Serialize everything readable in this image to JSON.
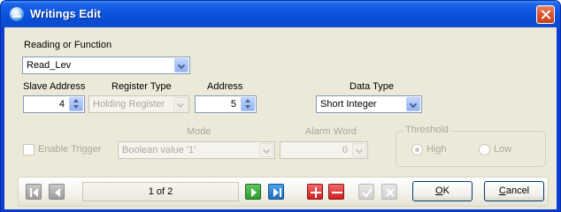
{
  "window": {
    "title": "Writings Edit",
    "close_icon": "close-icon"
  },
  "reading": {
    "label": "Reading or Function",
    "value": "Read_Lev"
  },
  "slave_address": {
    "label": "Slave Address",
    "value": "4"
  },
  "register_type": {
    "label": "Register Type",
    "value": "Holding Register"
  },
  "address": {
    "label": "Address",
    "value": "5"
  },
  "data_type": {
    "label": "Data Type",
    "value": "Short Integer"
  },
  "trigger": {
    "label": "Enable Trigger",
    "checked": false
  },
  "mode": {
    "label": "Mode",
    "value": "Boolean value '1'"
  },
  "alarm_word": {
    "label": "Alarm Word",
    "value": "0"
  },
  "threshold": {
    "label": "Threshold",
    "options": [
      "High",
      "Low"
    ],
    "selected": "High"
  },
  "navigation": {
    "page": "1 of 2"
  },
  "buttons": {
    "ok": "OK",
    "ok_mnemonic": "O",
    "ok_rest": "K",
    "cancel": "Cancel",
    "cancel_mnemonic": "C",
    "cancel_rest": "ancel"
  },
  "colors": {
    "title_bar": "#0a4bd1",
    "client": "#ece9d8",
    "nav_green": "#2f9a2f",
    "nav_blue": "#1f6ec0",
    "nav_red": "#cf2020"
  }
}
